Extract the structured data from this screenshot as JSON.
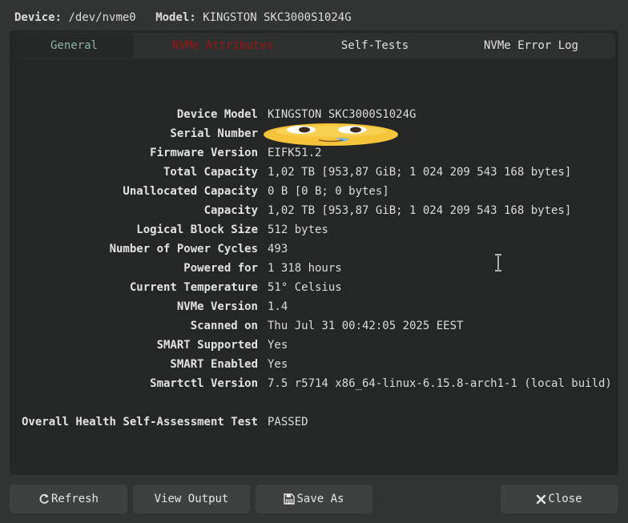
{
  "header": {
    "device_label": "Device:",
    "device_value": "/dev/nvme0",
    "model_label": "Model:",
    "model_value": "KINGSTON SKC3000S1024G"
  },
  "tabs": [
    {
      "label": "General",
      "state": "active"
    },
    {
      "label": "NVMe Attributes",
      "state": "warning"
    },
    {
      "label": "Self-Tests",
      "state": "normal"
    },
    {
      "label": "NVMe Error Log",
      "state": "normal"
    }
  ],
  "info": [
    {
      "key": "Device Model",
      "value": "KINGSTON SKC3000S1024G"
    },
    {
      "key": "Serial Number",
      "value": "",
      "redacted": "emoji-sticker"
    },
    {
      "key": "Firmware Version",
      "value": "EIFK51.2"
    },
    {
      "key": "Total Capacity",
      "value": "1,02 TB [953,87 GiB; 1 024 209 543 168 bytes]"
    },
    {
      "key": "Unallocated Capacity",
      "value": "0 B [0 B; 0 bytes]"
    },
    {
      "key": "Capacity",
      "value": "1,02 TB [953,87 GiB; 1 024 209 543 168 bytes]"
    },
    {
      "key": "Logical Block Size",
      "value": "512 bytes"
    },
    {
      "key": "Number of Power Cycles",
      "value": "493"
    },
    {
      "key": "Powered for",
      "value": "1 318 hours"
    },
    {
      "key": "Current Temperature",
      "value": "51° Celsius"
    },
    {
      "key": "NVMe Version",
      "value": "1.4"
    },
    {
      "key": "Scanned on",
      "value": "Thu Jul 31 00:42:05 2025 EEST"
    },
    {
      "key": "SMART Supported",
      "value": "Yes"
    },
    {
      "key": "SMART Enabled",
      "value": "Yes"
    },
    {
      "key": "Smartctl Version",
      "value": "7.5 r5714 x86_64-linux-6.15.8-arch1-1 (local build)"
    }
  ],
  "health": {
    "key": "Overall Health Self-Assessment Test",
    "value": "PASSED"
  },
  "buttons": {
    "refresh": {
      "label": "Refresh",
      "icon": "refresh-icon"
    },
    "view_output": {
      "label": "View Output"
    },
    "save_as": {
      "label": "Save As",
      "icon": "save-icon"
    },
    "close": {
      "label": "Close",
      "icon": "close-icon"
    }
  },
  "colors": {
    "window_bg": "#323433",
    "panel_bg": "#252626",
    "active_tab_text": "#8fb3a8",
    "warning_tab_text": "#9e1414",
    "button_bg": "#3f4140"
  }
}
